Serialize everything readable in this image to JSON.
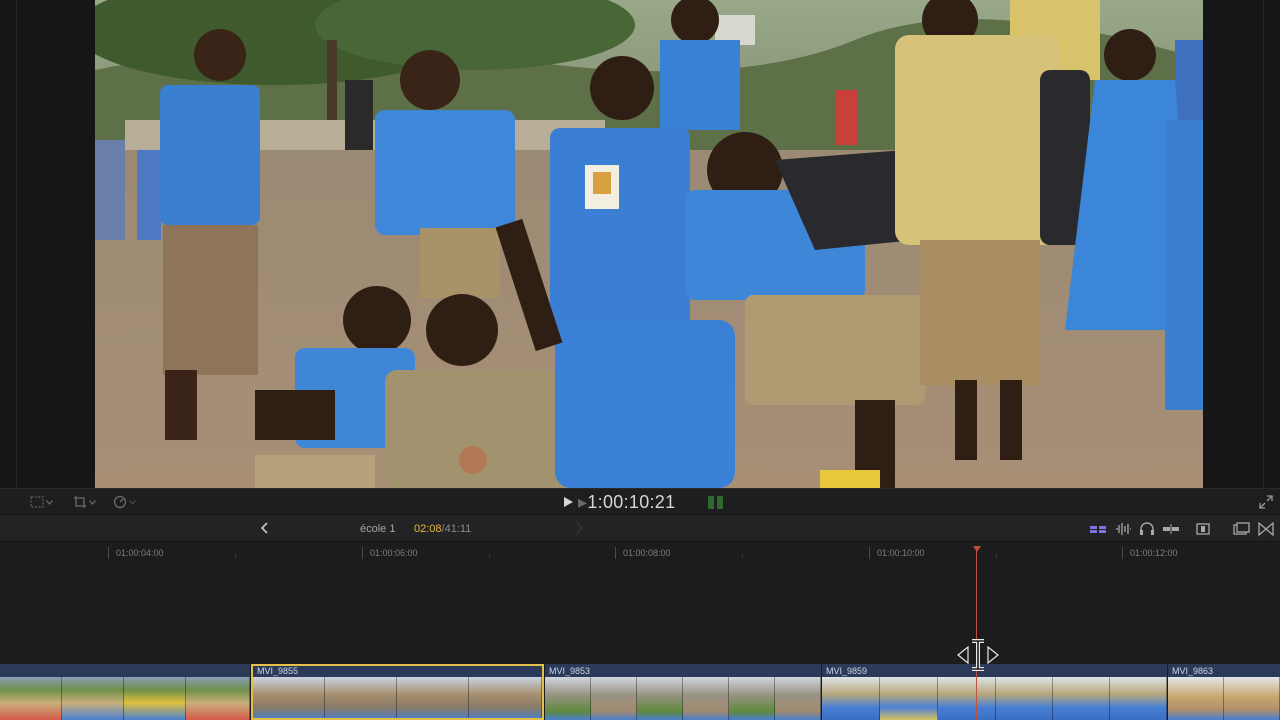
{
  "app": {
    "timecode_prefix": "▸",
    "timecode": "1:00:10:21"
  },
  "timeline_header": {
    "project_name": "école 1",
    "current_time": "02:08",
    "total_time": "/41:11"
  },
  "ruler": {
    "ticks": [
      "01:00:04:00",
      "01:00:06:00",
      "01:00:08:00",
      "01:00:10:00",
      "01:00:12:00"
    ]
  },
  "clips": [
    {
      "label": ""
    },
    {
      "label": "MVI_9855"
    },
    {
      "label": "MVI_9853"
    },
    {
      "label": "MVI_9859"
    },
    {
      "label": "MVI_9863"
    }
  ],
  "icons": {
    "transform": "transform-icon",
    "crop": "crop-icon",
    "speed": "speed-icon",
    "play": "play-icon",
    "fullscreen": "fullscreen-icon",
    "back": "chevron-left-icon",
    "forward": "chevron-right-icon",
    "clip_appearance": "clip-appearance-icon",
    "audio_waveform": "audio-waveform-icon",
    "headphones": "headphones-icon",
    "skimming": "skimming-icon",
    "snapping": "snapping-icon",
    "effects_browser": "effects-browser-icon",
    "transitions_browser": "transitions-browser-icon"
  },
  "colors": {
    "accent_selection": "#e2c04a",
    "playhead": "#c0503e",
    "clip_blue": "#2c3a5a",
    "current_time": "#e8b838",
    "audio_meter": "#2e6a2e",
    "active_icon": "#7d74e0"
  }
}
